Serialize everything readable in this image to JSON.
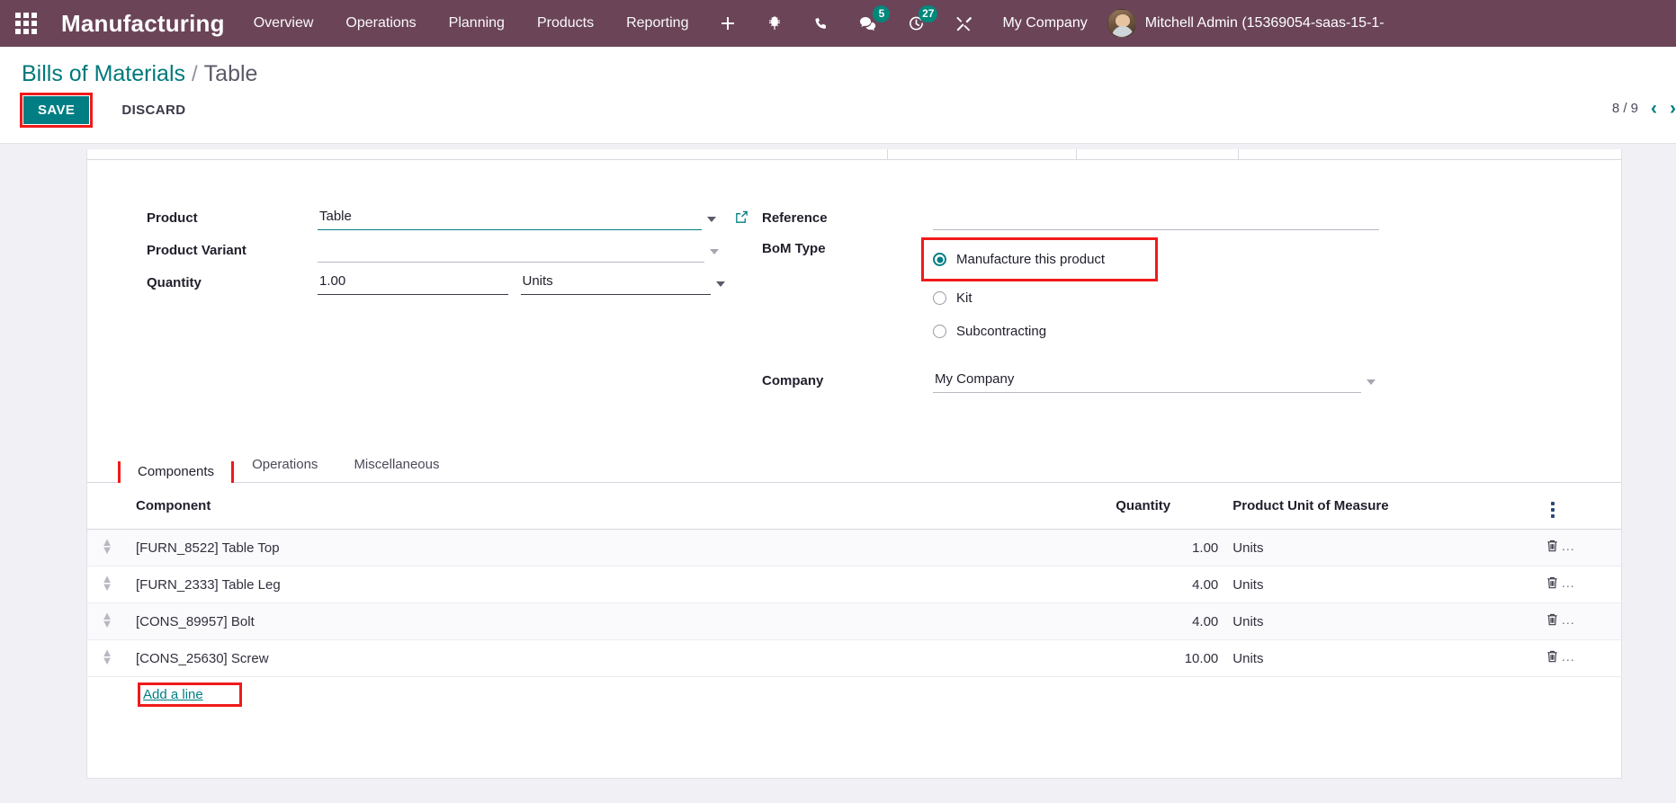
{
  "navbar": {
    "apps_icon": "apps-grid-icon",
    "brand": "Manufacturing",
    "menus": [
      {
        "label": "Overview"
      },
      {
        "label": "Operations"
      },
      {
        "label": "Planning"
      },
      {
        "label": "Products"
      },
      {
        "label": "Reporting"
      }
    ],
    "icons": [
      {
        "name": "plus-icon",
        "badge": ""
      },
      {
        "name": "bug-icon",
        "badge": ""
      },
      {
        "name": "phone-icon",
        "badge": ""
      },
      {
        "name": "messages-icon",
        "badge": "5"
      },
      {
        "name": "activity-clock-icon",
        "badge": "27"
      },
      {
        "name": "tools-icon",
        "badge": ""
      }
    ],
    "company": "My Company",
    "user": "Mitchell Admin (15369054-saas-15-1-"
  },
  "control_panel": {
    "breadcrumb_root": "Bills of Materials",
    "breadcrumb_separator": "/",
    "breadcrumb_current": "Table",
    "save_label": "SAVE",
    "discard_label": "DISCARD",
    "pager_text": "8 / 9",
    "pager_prev": "‹",
    "pager_next": "›"
  },
  "form": {
    "left": {
      "product_label": "Product",
      "product_value": "Table",
      "product_external_link_icon": "external-link-icon",
      "variant_label": "Product Variant",
      "variant_value": "",
      "quantity_label": "Quantity",
      "quantity_value": "1.00",
      "uom_value": "Units"
    },
    "right": {
      "reference_label": "Reference",
      "reference_value": "",
      "bom_type_label": "BoM Type",
      "bom_type_options": [
        {
          "label": "Manufacture this product",
          "selected": true
        },
        {
          "label": "Kit",
          "selected": false
        },
        {
          "label": "Subcontracting",
          "selected": false
        }
      ],
      "company_label": "Company",
      "company_value": "My Company"
    }
  },
  "notebook": {
    "tabs": [
      {
        "label": "Components",
        "active": true
      },
      {
        "label": "Operations",
        "active": false
      },
      {
        "label": "Miscellaneous",
        "active": false
      }
    ]
  },
  "components_table": {
    "columns": [
      "Component",
      "Quantity",
      "Product Unit of Measure"
    ],
    "optional_columns_icon": "vertical-dots-icon",
    "rows": [
      {
        "component": "[FURN_8522] Table Top",
        "quantity": "1.00",
        "uom": "Units",
        "delete_icon": "trash-icon",
        "overflow": "..."
      },
      {
        "component": "[FURN_2333] Table Leg",
        "quantity": "4.00",
        "uom": "Units",
        "delete_icon": "trash-icon",
        "overflow": "..."
      },
      {
        "component": "[CONS_89957] Bolt",
        "quantity": "4.00",
        "uom": "Units",
        "delete_icon": "trash-icon",
        "overflow": "..."
      },
      {
        "component": "[CONS_25630] Screw",
        "quantity": "10.00",
        "uom": "Units",
        "delete_icon": "trash-icon",
        "overflow": "..."
      }
    ],
    "add_line_label": "Add a line"
  },
  "colors": {
    "navbar_bg": "#6b4458",
    "accent_teal": "#017e84",
    "badge_teal": "#00887a",
    "highlight_red": "#f01a1a"
  }
}
